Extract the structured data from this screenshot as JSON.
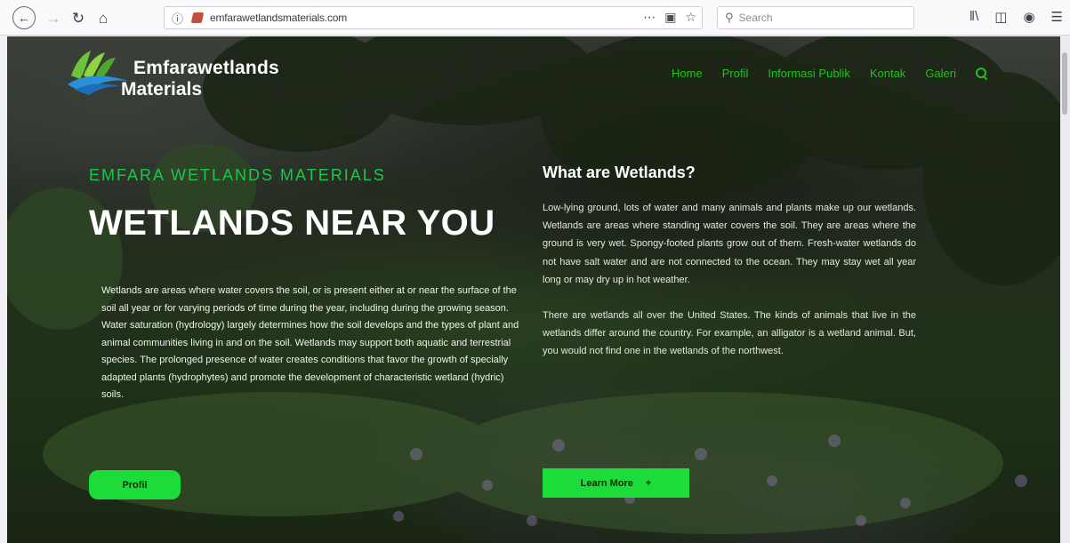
{
  "browser": {
    "url": "emfarawetlandsmaterials.com",
    "search_placeholder": "Search",
    "icons": {
      "back": "back-arrow-icon",
      "forward": "forward-arrow-icon",
      "reload": "reload-icon",
      "home": "home-icon",
      "page_actions": "ellipsis-icon",
      "pocket": "pocket-icon",
      "bookmark": "star-icon",
      "library": "library-icon",
      "sidebar": "sidebar-icon",
      "account": "account-icon",
      "menu": "hamburger-menu-icon"
    }
  },
  "site": {
    "logo": {
      "line1": "Emfarawetlands",
      "line2": "Materials"
    },
    "nav": {
      "items": [
        "Home",
        "Profil",
        "Informasi Publik",
        "Kontak",
        "Galeri"
      ]
    },
    "hero": {
      "kicker": "EMFARA WETLANDS MATERIALS",
      "title": "WETLANDS NEAR YOU",
      "paragraph": "Wetlands are areas where water covers the soil, or is present either at or near the surface of the soil all year or for varying periods of time during the year, including during the growing season. Water saturation (hydrology) largely determines how the soil develops and the types of plant and animal communities living in and on the soil. Wetlands may support both aquatic and terrestrial species. The prolonged presence of water creates conditions that favor the growth of specially adapted plants (hydrophytes) and promote the development of characteristic wetland (hydric) soils.",
      "button": "Profil"
    },
    "info": {
      "title": "What are Wetlands?",
      "paragraph1": "Low-lying ground, lots of water and many animals and plants make up our wetlands. Wetlands are areas where standing water covers the soil. They are areas where the ground is very wet. Spongy-footed plants grow out of them. Fresh-water wetlands do not have salt water and are not connected to the ocean. They may stay wet all year long or may dry up in hot weather.",
      "paragraph2": "There are wetlands all over the United States. The kinds of animals that live in the wetlands differ around the country. For example, an alligator is a wetland animal. But, you would not find one in the wetlands of the northwest.",
      "button": "Learn More",
      "button_icon": "+"
    },
    "colors": {
      "accent_green": "#1cdc3a",
      "nav_green": "#22c21c",
      "kicker_green": "#19c74a"
    }
  }
}
